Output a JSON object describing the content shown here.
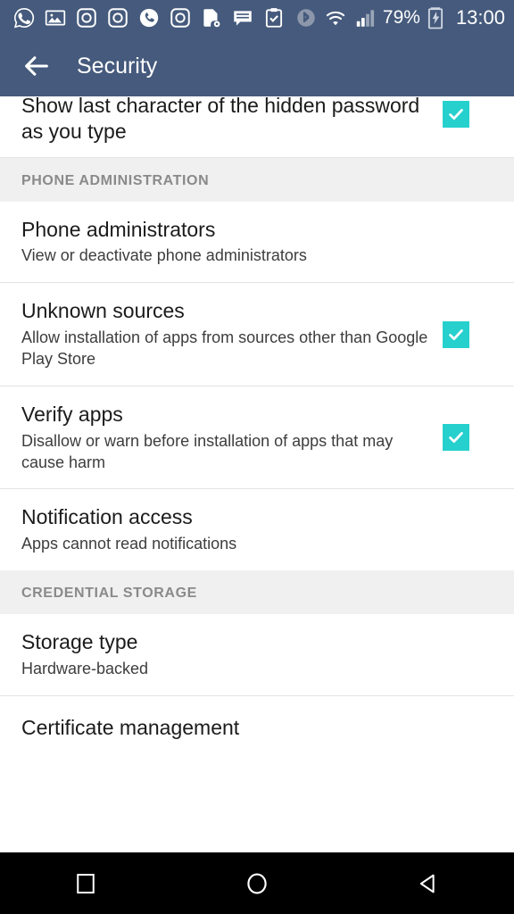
{
  "status_bar": {
    "notification_icons": [
      {
        "name": "whatsapp-icon"
      },
      {
        "name": "gallery-image-icon"
      },
      {
        "name": "camera-instagram-icon"
      },
      {
        "name": "camera-instagram-icon"
      },
      {
        "name": "missed-call-icon"
      },
      {
        "name": "camera-instagram-icon"
      },
      {
        "name": "file-settings-icon"
      },
      {
        "name": "message-icon"
      },
      {
        "name": "clipboard-check-icon"
      }
    ],
    "bluetooth_icon": "bluetooth-icon",
    "wifi_icon": "wifi-icon",
    "signal_icon": "signal-bars-icon",
    "battery_percent": "79%",
    "battery_icon": "battery-charging-icon",
    "clock": "13:00",
    "background_color": "#455a7c"
  },
  "app_bar": {
    "back_icon": "back-arrow-icon",
    "title": "Security",
    "background_color": "#455a7c"
  },
  "theme": {
    "accent_color": "#26d0cd",
    "section_bg": "#f0f0f0",
    "divider_color": "#e3e3e3"
  },
  "list": {
    "clipped_item": {
      "title": "Show last character of the hidden password as you type",
      "checked": true
    },
    "sections": [
      {
        "header": "PHONE ADMINISTRATION",
        "items": [
          {
            "title": "Phone administrators",
            "subtitle": "View or deactivate phone administrators",
            "has_checkbox": false
          },
          {
            "title": "Unknown sources",
            "subtitle": "Allow installation of apps from sources other than Google Play Store",
            "has_checkbox": true,
            "checked": true
          },
          {
            "title": "Verify apps",
            "subtitle": "Disallow or warn before installation of apps that may cause harm",
            "has_checkbox": true,
            "checked": true
          },
          {
            "title": "Notification access",
            "subtitle": "Apps cannot read notifications",
            "has_checkbox": false
          }
        ]
      },
      {
        "header": "CREDENTIAL STORAGE",
        "items": [
          {
            "title": "Storage type",
            "subtitle": "Hardware-backed",
            "has_checkbox": false
          },
          {
            "title": "Certificate management",
            "subtitle": "",
            "has_checkbox": false
          }
        ]
      }
    ]
  },
  "nav_bar": {
    "recents_icon": "recents-square-icon",
    "home_icon": "home-circle-icon",
    "back_icon": "back-triangle-icon",
    "background_color": "#000000"
  }
}
